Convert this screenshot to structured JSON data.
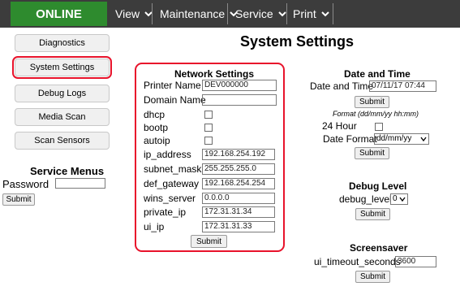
{
  "nav": {
    "status": "ONLINE",
    "menus": [
      "View",
      "Maintenance",
      "Service",
      "Print"
    ]
  },
  "sidebar": {
    "buttons": [
      "Diagnostics",
      "System Settings",
      "Debug Logs",
      "Media Scan",
      "Scan Sensors"
    ],
    "active": "System Settings",
    "service_menus_title": "Service Menus",
    "password_label": "Password",
    "password_value": "",
    "submit_label": "Submit"
  },
  "page_title": "System Settings",
  "network": {
    "title": "Network Settings",
    "printer_name_label": "Printer Name",
    "printer_name_value": "DEV000000",
    "domain_name_label": "Domain Name",
    "domain_name_value": "",
    "dhcp_label": "dhcp",
    "bootp_label": "bootp",
    "autoip_label": "autoip",
    "ip_address_label": "ip_address",
    "ip_address_value": "192.168.254.192",
    "subnet_mask_label": "subnet_mask",
    "subnet_mask_value": "255.255.255.0",
    "def_gateway_label": "def_gateway",
    "def_gateway_value": "192.168.254.254",
    "wins_server_label": "wins_server",
    "wins_server_value": "0.0.0.0",
    "private_ip_label": "private_ip",
    "private_ip_value": "172.31.31.34",
    "ui_ip_label": "ui_ip",
    "ui_ip_value": "172.31.31.33",
    "submit_label": "Submit"
  },
  "datetime": {
    "title": "Date and Time",
    "label": "Date and Time",
    "value": "07/11/17 07:44",
    "submit_label": "Submit",
    "format_hint": "Format (dd/mm/yy hh:mm)",
    "hour24_label": "24 Hour",
    "date_format_label": "Date Format",
    "date_format_value": "dd/mm/yy",
    "submit2_label": "Submit"
  },
  "debug": {
    "title": "Debug Level",
    "label": "debug_level",
    "value": "0",
    "submit_label": "Submit"
  },
  "screensaver": {
    "title": "Screensaver",
    "label": "ui_timeout_seconds",
    "value": "3600",
    "submit_label": "Submit"
  },
  "colors": {
    "nav_bg": "#3c3c3c",
    "status_green": "#2e8b2e",
    "highlight_red": "#e8132b"
  }
}
